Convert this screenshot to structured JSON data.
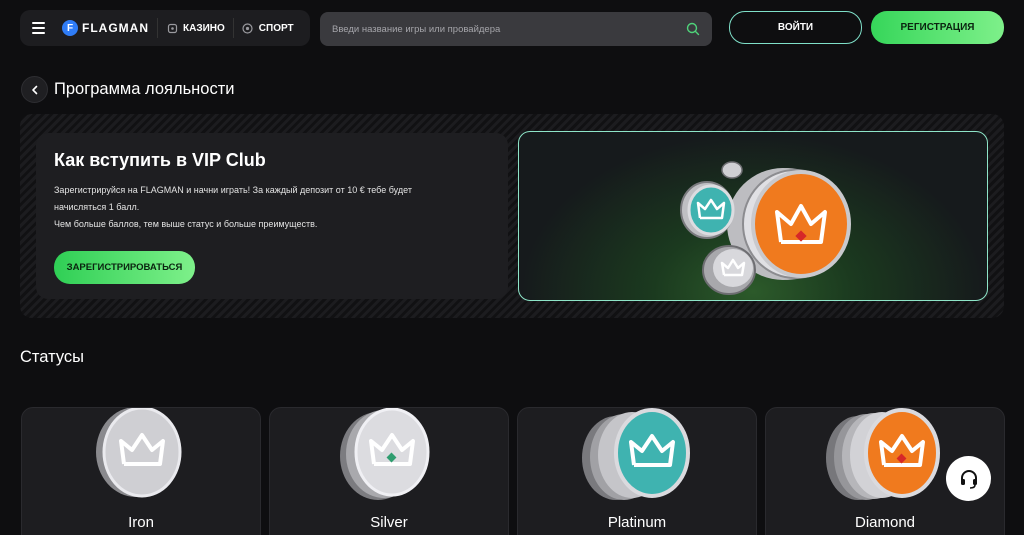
{
  "header": {
    "brand": "FLAGMAN",
    "brand_mark": "F",
    "nav": [
      {
        "label": "КАЗИНО",
        "icon": "casino-chip-icon"
      },
      {
        "label": "СПОРТ",
        "icon": "soccer-ball-icon"
      }
    ],
    "search_placeholder": "Введи название игры или провайдера",
    "login_label": "ВОЙТИ",
    "register_label": "РЕГИСТРАЦИЯ"
  },
  "page": {
    "title": "Программа лояльности"
  },
  "vip": {
    "title": "Как вступить в VIP Club",
    "line1": "Зарегистрируйся на FLAGMAN и начни играть! За каждый депозит от 10 € тебе будет",
    "line2": "начисляться 1 балл.",
    "line3": "Чем больше баллов, тем выше статус и больше преимуществ.",
    "cta_label": "ЗАРЕГИСТРИРОВАТЬСЯ"
  },
  "statuses": {
    "title": "Статусы",
    "items": [
      {
        "name": "Iron",
        "coin_color": "#c9c9cc"
      },
      {
        "name": "Silver",
        "coin_color": "#d8d8dc"
      },
      {
        "name": "Platinum",
        "coin_color": "#3fb3b0"
      },
      {
        "name": "Diamond",
        "coin_color": "#f07a1e"
      }
    ]
  },
  "colors": {
    "accent_green": "#36d65a",
    "accent_teal_border": "#7fe0c9",
    "background": "#0e0e10",
    "panel": "#1d1d20"
  },
  "icons": {
    "menu": "hamburger-menu-icon",
    "search": "search-icon",
    "back": "chevron-left-icon",
    "support": "headset-icon"
  }
}
